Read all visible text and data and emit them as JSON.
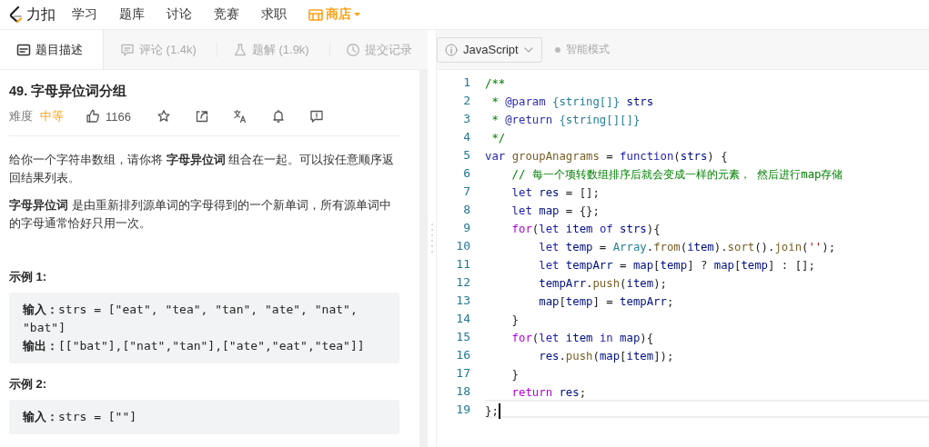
{
  "nav": {
    "logo_text": "力扣",
    "items": [
      {
        "label": "学习",
        "kind": "link"
      },
      {
        "label": "题库",
        "kind": "link"
      },
      {
        "label": "讨论",
        "kind": "link"
      },
      {
        "label": "竞赛",
        "kind": "link"
      },
      {
        "label": "求职",
        "kind": "link"
      },
      {
        "label": "商店",
        "kind": "store"
      }
    ]
  },
  "tabs": [
    {
      "label": "题目描述",
      "selected": true
    },
    {
      "label": "评论 (1.4k)",
      "selected": false
    },
    {
      "label": "题解 (1.9k)",
      "selected": false
    },
    {
      "label": "提交记录",
      "selected": false
    }
  ],
  "problem": {
    "title": "49. 字母异位词分组",
    "difficulty_label": "难度",
    "difficulty": "中等",
    "likes": "1166",
    "paragraphs": [
      "给你一个字符串数组，请你将 **字母异位词** 组合在一起。可以按任意顺序返回结果列表。",
      "**字母异位词** 是由重新排列源单词的字母得到的一个新单词，所有源单词中的字母通常恰好只用一次。"
    ],
    "examples": [
      {
        "title": "示例 1:",
        "lines": [
          "**输入：**strs = [\"eat\", \"tea\", \"tan\", \"ate\", \"nat\", \"bat\"]",
          "**输出：**[[\"bat\"],[\"nat\",\"tan\"],[\"ate\",\"eat\",\"tea\"]]"
        ]
      },
      {
        "title": "示例 2:",
        "lines": [
          "**输入：**strs = [\"\"]"
        ]
      }
    ]
  },
  "editor": {
    "language": "JavaScript",
    "mode_label": "智能模式",
    "mode_on": false,
    "lines": [
      {
        "number": "1",
        "active": false,
        "tokens": [
          {
            "text": "/**",
            "kind": "comment"
          }
        ]
      },
      {
        "number": "2",
        "active": false,
        "tokens": [
          {
            "text": " * ",
            "kind": "comment"
          },
          {
            "text": "@param ",
            "kind": "doctag"
          },
          {
            "text": "{string[]}",
            "kind": "type"
          },
          {
            "text": " strs",
            "kind": "var"
          }
        ]
      },
      {
        "number": "3",
        "active": false,
        "tokens": [
          {
            "text": " * ",
            "kind": "comment"
          },
          {
            "text": "@return ",
            "kind": "doctag"
          },
          {
            "text": "{string[][]}",
            "kind": "type"
          }
        ]
      },
      {
        "number": "4",
        "active": false,
        "tokens": [
          {
            "text": " */",
            "kind": "comment"
          }
        ]
      },
      {
        "number": "5",
        "active": false,
        "tokens": [
          {
            "text": "var ",
            "kind": "keyword"
          },
          {
            "text": "groupAnagrams",
            "kind": "func"
          },
          {
            "text": " = ",
            "kind": "plain"
          },
          {
            "text": "function",
            "kind": "keyword"
          },
          {
            "text": "(",
            "kind": "plain"
          },
          {
            "text": "strs",
            "kind": "var"
          },
          {
            "text": ") {",
            "kind": "plain"
          }
        ]
      },
      {
        "number": "6",
        "active": false,
        "tokens": [
          {
            "text": "    // 每一个项转数组排序后就会变成一样的元素， 然后进行map存储",
            "kind": "comment"
          }
        ]
      },
      {
        "number": "7",
        "active": false,
        "tokens": [
          {
            "text": "    let ",
            "kind": "keyword"
          },
          {
            "text": "res",
            "kind": "var"
          },
          {
            "text": " = [];",
            "kind": "plain"
          }
        ]
      },
      {
        "number": "8",
        "active": false,
        "tokens": [
          {
            "text": "    let ",
            "kind": "keyword"
          },
          {
            "text": "map",
            "kind": "var"
          },
          {
            "text": " = {};",
            "kind": "plain"
          }
        ]
      },
      {
        "number": "9",
        "active": false,
        "tokens": [
          {
            "text": "    for",
            "kind": "control"
          },
          {
            "text": "(",
            "kind": "plain"
          },
          {
            "text": "let ",
            "kind": "keyword"
          },
          {
            "text": "item ",
            "kind": "var"
          },
          {
            "text": "of ",
            "kind": "keyword"
          },
          {
            "text": "strs",
            "kind": "var"
          },
          {
            "text": "){",
            "kind": "plain"
          }
        ]
      },
      {
        "number": "10",
        "active": false,
        "tokens": [
          {
            "text": "        let ",
            "kind": "keyword"
          },
          {
            "text": "temp",
            "kind": "var"
          },
          {
            "text": " = ",
            "kind": "plain"
          },
          {
            "text": "Array",
            "kind": "class"
          },
          {
            "text": ".",
            "kind": "plain"
          },
          {
            "text": "from",
            "kind": "func"
          },
          {
            "text": "(",
            "kind": "plain"
          },
          {
            "text": "item",
            "kind": "var"
          },
          {
            "text": ").",
            "kind": "plain"
          },
          {
            "text": "sort",
            "kind": "func"
          },
          {
            "text": "().",
            "kind": "plain"
          },
          {
            "text": "join",
            "kind": "func"
          },
          {
            "text": "(",
            "kind": "plain"
          },
          {
            "text": "''",
            "kind": "string"
          },
          {
            "text": ");",
            "kind": "plain"
          }
        ]
      },
      {
        "number": "11",
        "active": false,
        "tokens": [
          {
            "text": "        let ",
            "kind": "keyword"
          },
          {
            "text": "tempArr",
            "kind": "var"
          },
          {
            "text": " = ",
            "kind": "plain"
          },
          {
            "text": "map",
            "kind": "var"
          },
          {
            "text": "[",
            "kind": "plain"
          },
          {
            "text": "temp",
            "kind": "var"
          },
          {
            "text": "] ? ",
            "kind": "plain"
          },
          {
            "text": "map",
            "kind": "var"
          },
          {
            "text": "[",
            "kind": "plain"
          },
          {
            "text": "temp",
            "kind": "var"
          },
          {
            "text": "] : [];",
            "kind": "plain"
          }
        ]
      },
      {
        "number": "12",
        "active": false,
        "tokens": [
          {
            "text": "        tempArr",
            "kind": "var"
          },
          {
            "text": ".",
            "kind": "plain"
          },
          {
            "text": "push",
            "kind": "func"
          },
          {
            "text": "(",
            "kind": "plain"
          },
          {
            "text": "item",
            "kind": "var"
          },
          {
            "text": ");",
            "kind": "plain"
          }
        ]
      },
      {
        "number": "13",
        "active": false,
        "tokens": [
          {
            "text": "        map",
            "kind": "var"
          },
          {
            "text": "[",
            "kind": "plain"
          },
          {
            "text": "temp",
            "kind": "var"
          },
          {
            "text": "] = ",
            "kind": "plain"
          },
          {
            "text": "tempArr",
            "kind": "var"
          },
          {
            "text": ";",
            "kind": "plain"
          }
        ]
      },
      {
        "number": "14",
        "active": false,
        "tokens": [
          {
            "text": "    }",
            "kind": "plain"
          }
        ]
      },
      {
        "number": "15",
        "active": false,
        "tokens": [
          {
            "text": "    for",
            "kind": "control"
          },
          {
            "text": "(",
            "kind": "plain"
          },
          {
            "text": "let ",
            "kind": "keyword"
          },
          {
            "text": "item ",
            "kind": "var"
          },
          {
            "text": "in ",
            "kind": "keyword"
          },
          {
            "text": "map",
            "kind": "var"
          },
          {
            "text": "){",
            "kind": "plain"
          }
        ]
      },
      {
        "number": "16",
        "active": false,
        "tokens": [
          {
            "text": "        res",
            "kind": "var"
          },
          {
            "text": ".",
            "kind": "plain"
          },
          {
            "text": "push",
            "kind": "func"
          },
          {
            "text": "(",
            "kind": "plain"
          },
          {
            "text": "map",
            "kind": "var"
          },
          {
            "text": "[",
            "kind": "plain"
          },
          {
            "text": "item",
            "kind": "var"
          },
          {
            "text": "]);",
            "kind": "plain"
          }
        ]
      },
      {
        "number": "17",
        "active": false,
        "tokens": [
          {
            "text": "    }",
            "kind": "plain"
          }
        ]
      },
      {
        "number": "18",
        "active": false,
        "tokens": [
          {
            "text": "    return ",
            "kind": "control"
          },
          {
            "text": "res",
            "kind": "var"
          },
          {
            "text": ";",
            "kind": "plain"
          }
        ]
      },
      {
        "number": "19",
        "active": true,
        "tokens": [
          {
            "text": "};",
            "kind": "plain"
          }
        ]
      }
    ]
  }
}
